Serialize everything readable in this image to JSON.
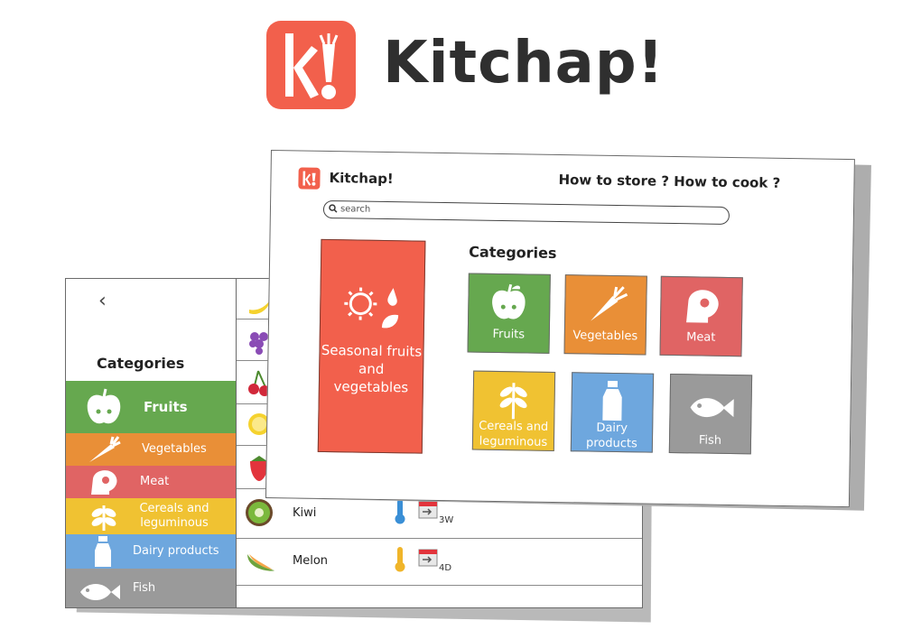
{
  "hero": {
    "title": "Kitchap!"
  },
  "colors": {
    "brand": "#f2604c",
    "fruits": "#66a84f",
    "vegetables": "#e98f37",
    "meat": "#e06464",
    "cereals": "#f0c232",
    "dairy": "#6ea7de",
    "fish": "#9a9a9a"
  },
  "front": {
    "app_title": "Kitchap!",
    "tagline": "How to store ? How to cook ?",
    "search_placeholder": "search",
    "seasonal_label": "Seasonal fruits and vegetables",
    "categories_title": "Categories",
    "categories": [
      {
        "label": "Fruits",
        "icon": "apple-icon"
      },
      {
        "label": "Vegetables",
        "icon": "carrot-icon"
      },
      {
        "label": "Meat",
        "icon": "steak-icon"
      },
      {
        "label": "Cereals and leguminous",
        "icon": "wheat-icon"
      },
      {
        "label": "Dairy products",
        "icon": "milk-bottle-icon"
      },
      {
        "label": "Fish",
        "icon": "fish-icon"
      }
    ]
  },
  "back": {
    "back_icon": "chevron-left-icon",
    "categories_title": "Categories",
    "categories": [
      {
        "label": "Fruits"
      },
      {
        "label": "Vegetables"
      },
      {
        "label": "Meat"
      },
      {
        "label": "Cereals and leguminous"
      },
      {
        "label": "Dairy products"
      },
      {
        "label": "Fish"
      }
    ],
    "rows": [
      {
        "name": "Kiwi",
        "storage_icon": "thermometer-icon",
        "duration": "3W"
      },
      {
        "name": "Melon",
        "storage_icon": "thermometer-icon",
        "duration": "4D"
      }
    ]
  }
}
